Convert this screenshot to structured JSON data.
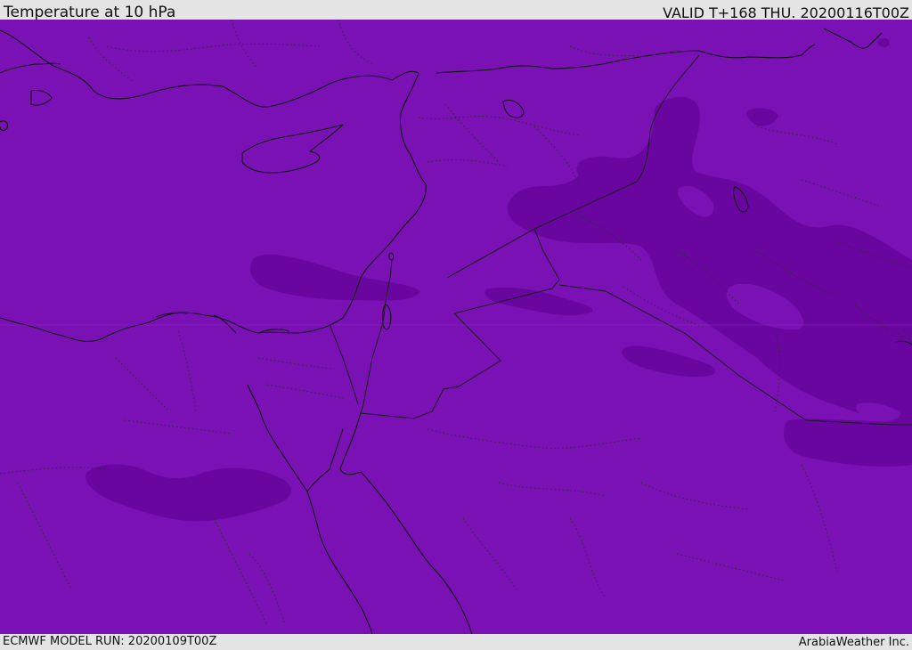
{
  "header": {
    "title": "Temperature at 10 hPa",
    "valid_time": "VALID T+168 THU. 20200116T00Z"
  },
  "footer": {
    "model_run": "ECMWF MODEL RUN: 20200109T00Z",
    "credit": "ArabiaWeather Inc."
  },
  "map": {
    "colors": {
      "field_base": "#7a11b4",
      "field_cold": "#69069f",
      "field_colder": "#6a08a0",
      "field_warm": "#8a26c0",
      "coastline": "#111111",
      "border": "#1a1a1a"
    }
  }
}
